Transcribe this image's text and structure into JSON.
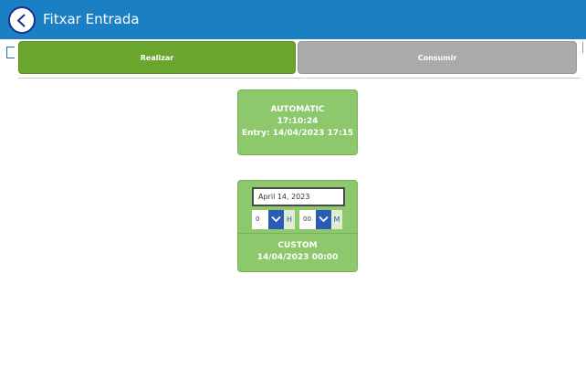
{
  "header": {
    "title": "Fitxar Entrada",
    "back_icon": "chevron-left-icon"
  },
  "tabs": [
    {
      "label": "Realizar",
      "active": true,
      "color": "#6aa52e"
    },
    {
      "label": "Consumir",
      "active": false,
      "color": "#aaaaaa"
    }
  ],
  "automatic": {
    "label": "AUTOMÀTIC",
    "time": "17:10:24",
    "entry": "Entry: 14/04/2023 17:15"
  },
  "custom": {
    "date_value": "April 14, 2023",
    "hour_value": "0",
    "hour_unit": "H",
    "minute_value": "00",
    "minute_unit": "M",
    "label": "CUSTOM",
    "datetime": "14/04/2023 00:00"
  },
  "colors": {
    "header": "#1a7fc3",
    "card": "#8dc86d",
    "dropdown": "#2a5bb5"
  }
}
